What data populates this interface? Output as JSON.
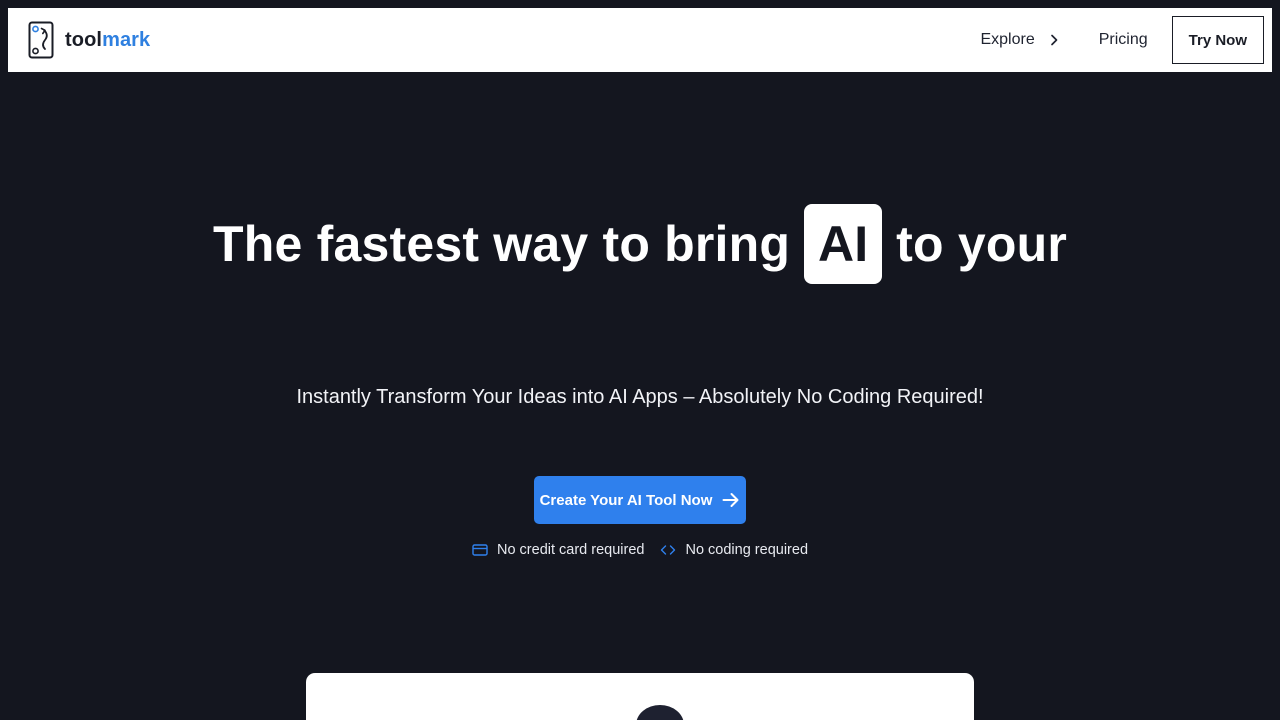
{
  "brand": {
    "name_part1": "tool",
    "name_part2": "mark",
    "icon": "toolmark-logo-icon"
  },
  "nav": {
    "explore_label": "Explore",
    "pricing_label": "Pricing",
    "try_label": "Try Now"
  },
  "hero": {
    "title_before": "The fastest way to bring",
    "title_highlight": "AI",
    "title_after": "to your",
    "subtitle": "Instantly Transform Your Ideas into AI Apps – Absolutely No Coding Required!",
    "cta_label": "Create Your AI Tool Now",
    "notes": [
      {
        "icon": "credit-card-icon",
        "label": "No credit card required"
      },
      {
        "icon": "code-icon",
        "label": "No coding required"
      }
    ]
  },
  "colors": {
    "background": "#14161f",
    "accent": "#2f80ed",
    "brand_accent": "#2f80e0",
    "header_bg": "#ffffff"
  }
}
